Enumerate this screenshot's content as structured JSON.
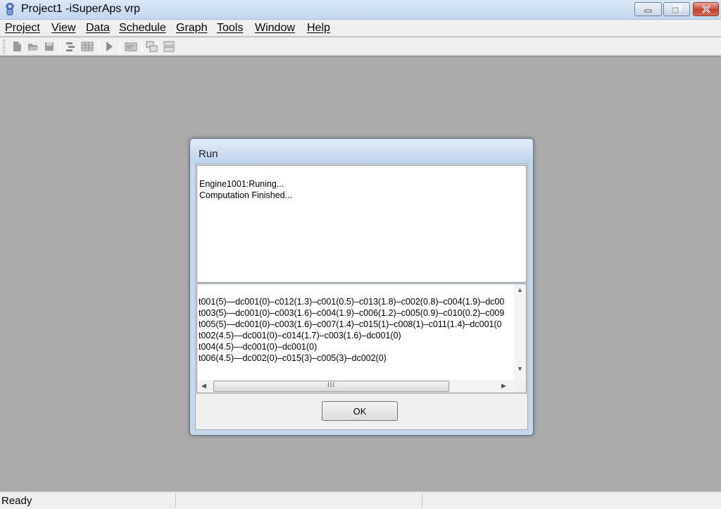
{
  "window": {
    "title": "Project1 -iSuperAps vrp",
    "icon": "app-icon",
    "controls": [
      "minimize-icon",
      "restore-icon",
      "close-icon"
    ]
  },
  "menu": {
    "items": [
      "Project",
      "View",
      "Data",
      "Schedule",
      "Graph",
      "Tools",
      "Window",
      "Help"
    ]
  },
  "toolbar": {
    "icons": [
      "new-icon",
      "open-icon",
      "save-icon",
      "gantt-icon",
      "table-icon",
      "run-icon",
      "report-icon",
      "cascade-icon",
      "tile-icon"
    ]
  },
  "dialog": {
    "title": "Run",
    "log_lines": [
      "Engine1001:Runing...",
      "Computation Finished..."
    ],
    "result_lines": [
      "t001(5)—dc001(0)–c012(1.3)–c001(0.5)–c013(1.8)–c002(0.8)–c004(1.9)–dc00",
      "t003(5)—dc001(0)–c003(1.6)–c004(1.9)–c006(1.2)–c005(0.9)–c010(0.2)–c009",
      "t005(5)—dc001(0)–c003(1.6)–c007(1.4)–c015(1)–c008(1)–c011(1.4)–dc001(0",
      "t002(4.5)—dc001(0)–c014(1.7)–c003(1.6)–dc001(0)",
      "t004(4.5)—dc001(0)–dc001(0)",
      "t006(4.5)—dc002(0)–c015(3)–c005(3)–dc002(0)"
    ],
    "hscroll_grip": "III",
    "ok_label": "OK"
  },
  "status": {
    "text": "Ready"
  },
  "colors": {
    "mdi_background": "#ababab",
    "dialog_frame": "#c5d8ee",
    "title_gradient_top": "#dbe8f6",
    "close_button": "#c7422b"
  }
}
